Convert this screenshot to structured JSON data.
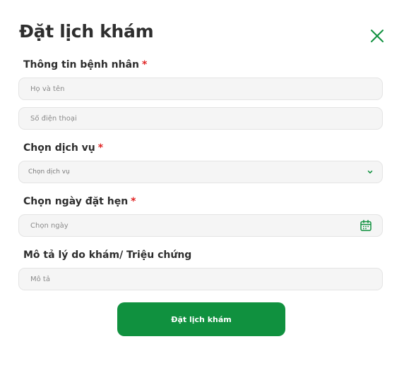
{
  "modal": {
    "title": "Đặt lịch khám"
  },
  "patient_info": {
    "label": "Thông tin bệnh nhân",
    "required_mark": "*",
    "name_placeholder": "Họ và tên",
    "phone_placeholder": "Số điện thoại"
  },
  "service": {
    "label": "Chọn dịch vụ",
    "required_mark": "*",
    "selected_text": "Chọn dịch vụ"
  },
  "appointment_date": {
    "label": "Chọn ngày đặt hẹn",
    "required_mark": "*",
    "placeholder": "Chọn ngày"
  },
  "description": {
    "label": "Mô tả lý do khám/ Triệu chứng",
    "placeholder": "Mô tả"
  },
  "submit": {
    "label": "Đặt lịch khám"
  },
  "icons": {
    "close": "close-icon",
    "chevron": "chevron-down-icon",
    "calendar": "calendar-icon"
  },
  "colors": {
    "accent": "#10913f",
    "required": "#e02424",
    "field_bg": "#f5f5f5"
  }
}
